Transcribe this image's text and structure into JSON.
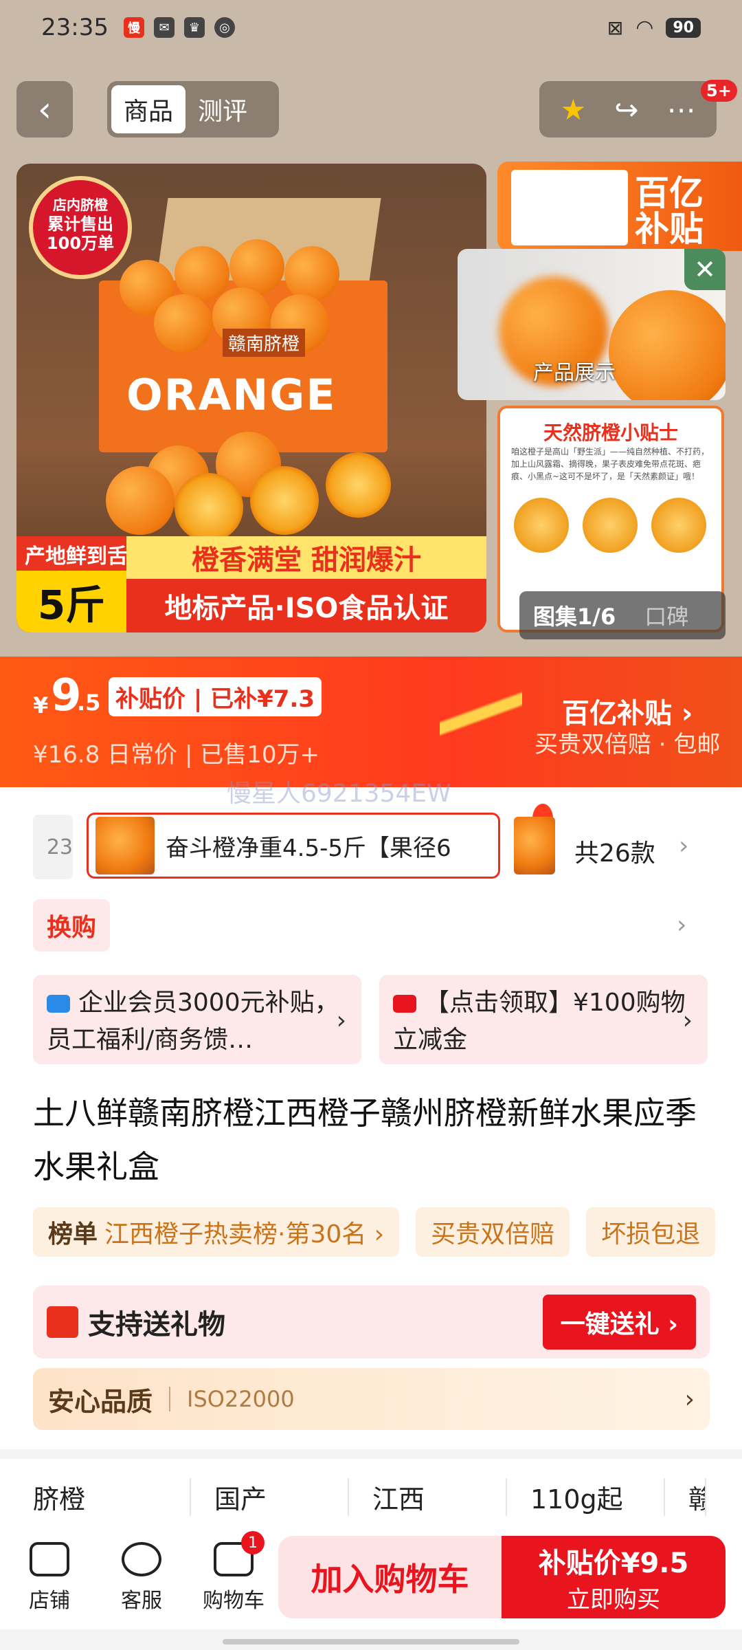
{
  "status": {
    "time": "23:35",
    "battery": "90"
  },
  "nav": {
    "back": "‹",
    "tabs": [
      "商品",
      "测评"
    ],
    "badge": "5+"
  },
  "hero": {
    "seal": [
      "店内脐橙",
      "累计售出",
      "100万单"
    ],
    "box_text": "ORANGE",
    "box_sub": "赣南脐橙",
    "band_tag": "产地鲜到舌尖",
    "band_weight": "5斤",
    "band_line1": "橙香满堂  甜润爆汁",
    "band_line2": "地标产品·ISO食品认证"
  },
  "side": {
    "top_text": "百亿\n补贴",
    "preview_label": "产品展示",
    "card_title": "天然脐橙小贴士",
    "card_body": "咱这橙子是高山「野生派」——纯自然种植、不打药，加上山风露霜、摘得晚，果子表皮难免带点花斑、疤痕、小黑点~这可不是坏了，是「天然素颜证」哦！",
    "gallery": "图集1/6",
    "reviews": "口碑"
  },
  "price": {
    "currency": "¥",
    "int": "9",
    "dec": ".5",
    "tag": "补贴价 | 已补¥7.3",
    "old": "¥16.8 日常价 | 已售10万+",
    "brand": "百亿补贴 ›",
    "brand_sub": "买贵双倍赔 · 包邮"
  },
  "watermark": "慢星人6921354EW",
  "sku": {
    "prev": "23",
    "selected": "奋斗橙净重4.5-5斤【果径6",
    "count": "共26款",
    "chevron": "›"
  },
  "swap": "换购",
  "coupons": [
    {
      "text": "企业会员3000元补贴，员工福利/商务馈…",
      "color": "#2a8ae8"
    },
    {
      "text": "【点击领取】¥100购物立减金",
      "color": "#e8141e"
    }
  ],
  "title": "土八鲜赣南脐橙江西橙子赣州脐橙新鲜水果应季水果礼盒",
  "ranks": [
    {
      "label": "榜单",
      "text": "江西橙子热卖榜·第30名 ›"
    },
    {
      "label": "",
      "text": "买贵双倍赔"
    },
    {
      "label": "",
      "text": "坏损包退"
    }
  ],
  "gift": {
    "text": "支持送礼物",
    "button": "一键送礼 ›"
  },
  "quality": {
    "label": "安心品质",
    "value": "ISO22000",
    "chevron": "›"
  },
  "attrs": [
    "脐橙",
    "国产",
    "江西",
    "110g起",
    "赣"
  ],
  "bottom": {
    "shop": "店铺",
    "service": "客服",
    "cart": "购物车",
    "cart_count": "1",
    "add_cart": "加入购物车",
    "buy_price": "补贴价¥9.5",
    "buy_now": "立即购买"
  },
  "colors": {
    "accent": "#e8141e",
    "price_band": "#ff4a1a"
  }
}
